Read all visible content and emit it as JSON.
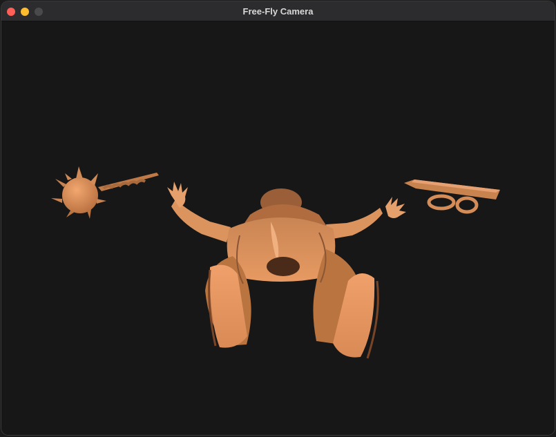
{
  "window": {
    "title": "Free-Fly Camera"
  },
  "colors": {
    "background": "#181717",
    "model_base": "#e59b68",
    "model_shadow": "#8a5535",
    "model_highlight": "#f7b07a"
  },
  "scene": {
    "objects": [
      "spiked-mace",
      "armored-figure",
      "floating-platform"
    ]
  }
}
